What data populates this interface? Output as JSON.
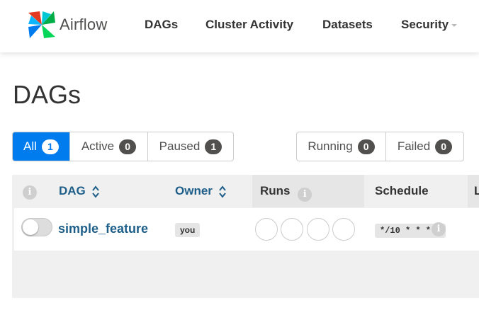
{
  "navbar": {
    "brand": "Airflow",
    "items": [
      "DAGs",
      "Cluster Activity",
      "Datasets",
      "Security"
    ]
  },
  "page": {
    "title": "DAGs"
  },
  "filters": {
    "status": [
      {
        "label": "All",
        "count": "1",
        "active": true
      },
      {
        "label": "Active",
        "count": "0",
        "active": false
      },
      {
        "label": "Paused",
        "count": "1",
        "active": false
      }
    ],
    "state": [
      {
        "label": "Running",
        "count": "0"
      },
      {
        "label": "Failed",
        "count": "0"
      }
    ]
  },
  "table": {
    "headers": {
      "dag": "DAG",
      "owner": "Owner",
      "runs": "Runs",
      "schedule": "Schedule",
      "last": "L"
    },
    "rows": [
      {
        "dag_id": "simple_feature",
        "owner": "you",
        "schedule": "*/10 * * * *",
        "paused": true,
        "run_states": 4
      }
    ]
  },
  "icons": {
    "info": "info-icon",
    "sort": "sort-icon",
    "caret": "caret-down-icon",
    "logo": "airflow-pinwheel-logo"
  },
  "colors": {
    "primary": "#017cee",
    "link": "#1e5f8a",
    "badge": "#51504f"
  }
}
